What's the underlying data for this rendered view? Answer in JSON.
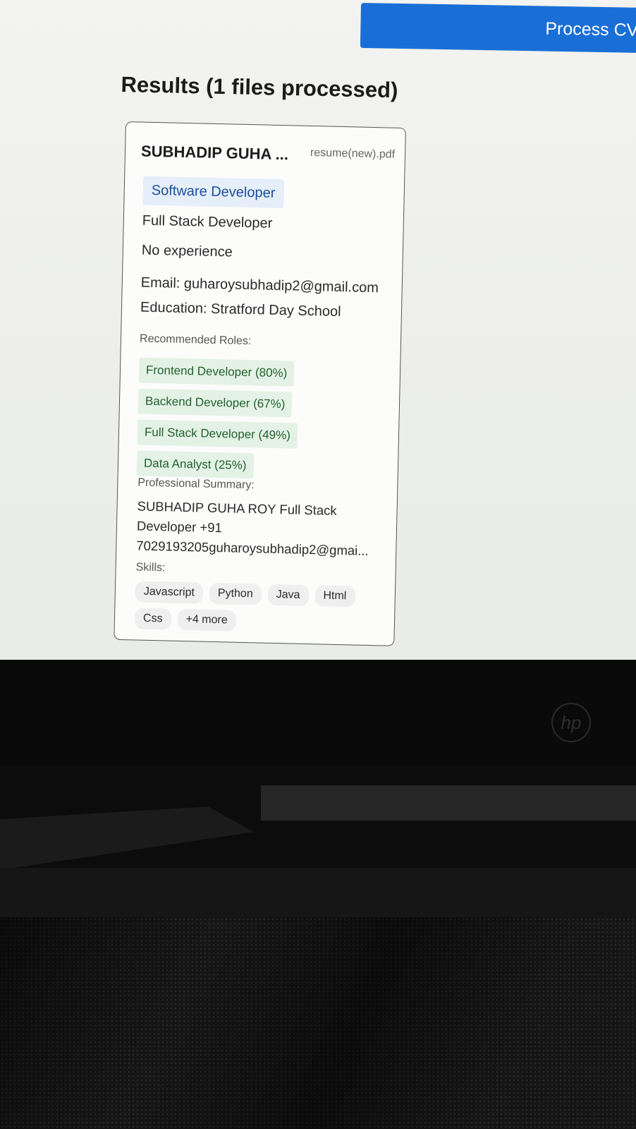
{
  "toolbar": {
    "process_label": "Process CVs"
  },
  "results": {
    "title": "Results (1 files processed)",
    "card": {
      "name": "SUBHADIP GUHA ...",
      "file": "resume(new).pdf",
      "predicted_role": "Software Developer",
      "title_line": "Full Stack Developer",
      "experience": "No experience",
      "email": "Email: guharoysubhadip2@gmail.com",
      "education": "Education: Stratford Day School",
      "recommended_label": "Recommended Roles:",
      "recommended_roles": [
        "Frontend Developer (80%)",
        "Backend Developer (67%)",
        "Full Stack Developer (49%)",
        "Data Analyst (25%)"
      ],
      "summary_label": "Professional Summary:",
      "summary_lines": [
        "SUBHADIP GUHA ROY Full Stack",
        "Developer +91",
        "7029193205guharoysubhadip2@gmai..."
      ],
      "skills_label": "Skills:",
      "skills": [
        "Javascript",
        "Python",
        "Java",
        "Html",
        "Css",
        "+4 more"
      ]
    }
  },
  "device": {
    "logo_text": "hp"
  },
  "colors": {
    "accent": "#1a6fd6",
    "role_chip_bg": "#e5eef9",
    "recommended_chip_bg": "#e4f2e6"
  }
}
